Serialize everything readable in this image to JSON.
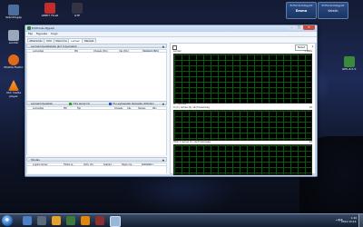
{
  "desktop": {
    "icons": [
      {
        "label": "Számítógép",
        "color": "#4c6e9e"
      },
      {
        "label": "Lomtár",
        "color": "#9aa7b8"
      },
      {
        "label": "Mozilla Firefox",
        "color": "#e06a1a"
      },
      {
        "label": "VLC media player",
        "color": "#f0870a"
      },
      {
        "label": "ABBYY FineR",
        "color": "#c52b2b"
      },
      {
        "label": "GTE",
        "color": "#333344"
      },
      {
        "label": "GPU-Z.0.5.",
        "color": "#3b8a3b"
      }
    ],
    "gadgets": [
      {
        "top": "Erőforrás-felügyelő",
        "big": "Emma"
      },
      {
        "top": "Erőforrás-felügyelő",
        "big": "Katalin"
      }
    ]
  },
  "window": {
    "title": "Erőforrás-figyelő",
    "menu": [
      "Fájl",
      "Figyelés",
      "Súgó"
    ],
    "tabs": [
      "Áttekintés",
      "CPU",
      "Memória",
      "Lemez",
      "Hálózat"
    ],
    "active_tab": "Lemez",
    "left": {
      "section1": {
        "title": "Lemezműveletekkel járó folyamatok",
        "columns": [
          "Lemezkép",
          "PID",
          "Olvasás (B/s)",
          "Írás (B/s)",
          "Összesen (B/s)"
        ]
      },
      "section2": {
        "title": "Lemezműveletek",
        "columns": [
          "Lemezkép",
          "PID",
          "Fájl",
          "Olvasás",
          "Írás",
          "Összes",
          "Vá..."
        ],
        "legend1": "0 B/s Lemez I/O",
        "legend2": "0% Leghosszabb ütemezési időtartam"
      },
      "section3": {
        "title": "Tárolás",
        "columns": [
          "Logikai lemez",
          "Fizikai le...",
          "Aktív idő...",
          "Szabad ...",
          "Teljes me...",
          "Lemezsor..."
        ]
      }
    },
    "right": {
      "nezet_label": "Nézet",
      "graphs": [
        {
          "label": "Lemez",
          "value": "1 MB/s",
          "foot": "60 másodperc"
        },
        {
          "label": "0 (C:) lemez (0) vár/hosszúság",
          "value": "10",
          "foot": ""
        },
        {
          "label": "HDD 1 lemez (1) vár/hosszúság",
          "value": "10",
          "foot": ""
        }
      ]
    }
  },
  "taskbar": {
    "start_glyph": "❖",
    "time": "1:26",
    "date": "2012.10.24."
  }
}
